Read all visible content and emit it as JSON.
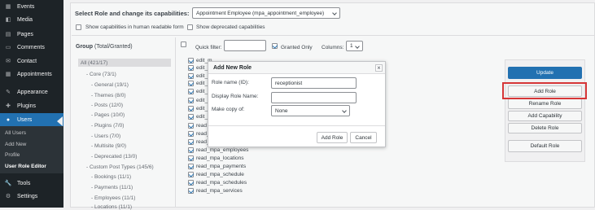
{
  "sidebar": {
    "items": [
      {
        "label": "Events",
        "icon": "calendar-icon"
      },
      {
        "label": "Media",
        "icon": "media-icon"
      },
      {
        "label": "Pages",
        "icon": "pages-icon"
      },
      {
        "label": "Comments",
        "icon": "comments-icon"
      },
      {
        "label": "Contact",
        "icon": "contact-icon"
      },
      {
        "label": "Appointments",
        "icon": "appointments-icon"
      },
      {
        "label": "Appearance",
        "icon": "appearance-icon"
      },
      {
        "label": "Plugins",
        "icon": "plugins-icon"
      },
      {
        "label": "Users",
        "icon": "users-icon"
      },
      {
        "label": "Tools",
        "icon": "tools-icon"
      },
      {
        "label": "Settings",
        "icon": "settings-icon"
      }
    ],
    "submenu": [
      "All Users",
      "Add New",
      "Profile",
      "User Role Editor"
    ]
  },
  "top": {
    "heading": "Select Role and change its capabilities:",
    "role_select": "Appointment Employee (mpa_appointment_employee)",
    "opt_human": "Show capabilities in human readable form",
    "opt_deprecated": "Show deprecated capabilities"
  },
  "groups": {
    "title": "Group",
    "title_count": "(Total/Granted)",
    "items": [
      "All (421/17)",
      "- Core (73/1)",
      "- General (19/1)",
      "- Themes (8/0)",
      "- Posts (12/0)",
      "- Pages (10/0)",
      "- Plugins (7/0)",
      "- Users (7/0)",
      "- Multisite (9/0)",
      "- Deprecated (13/0)",
      "- Custom Post Types (145/6)",
      "- Bookings (11/1)",
      "- Payments (11/1)",
      "- Employees (11/1)",
      "- Locations (11/1)"
    ]
  },
  "filter": {
    "quick_filter_label": "Quick filter:",
    "granted_only": "Granted Only",
    "columns_label": "Columns:",
    "columns_value": "1"
  },
  "caps": [
    "edit_m",
    "edit_m",
    "edit_m",
    "edit_m",
    "edit_m",
    "edit_m",
    "edit_m",
    "edit_m",
    "read",
    "read_m",
    "read_m",
    "read_mpa_employees",
    "read_mpa_locations",
    "read_mpa_payments",
    "read_mpa_schedule",
    "read_mpa_schedules",
    "read_mpa_services"
  ],
  "actions": {
    "update": "Update",
    "add_role": "Add Role",
    "rename_role": "Rename Role",
    "add_capability": "Add Capability",
    "delete_role": "Delete Role",
    "default_role": "Default Role"
  },
  "modal": {
    "title": "Add New Role",
    "close": "×",
    "role_name_label": "Role name (ID):",
    "role_name_value": "receptionist",
    "display_label": "Display Role Name:",
    "display_value": "",
    "copy_label": "Make copy of:",
    "copy_value": "None",
    "add_button": "Add Role",
    "cancel_button": "Cancel"
  },
  "colors": {
    "sidebar_bg": "#1d2327",
    "active_blue": "#2271b1",
    "highlight_red": "#d63638"
  }
}
